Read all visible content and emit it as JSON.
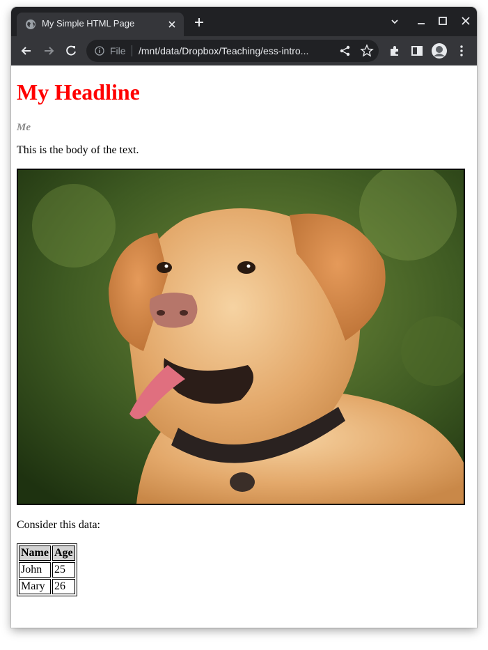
{
  "browser": {
    "tab_title": "My Simple HTML Page",
    "url_scheme": "File",
    "url": "/mnt/data/Dropbox/Teaching/ess-intro..."
  },
  "page": {
    "headline": "My Headline",
    "headline_color": "#ff0000",
    "author": "Me",
    "body_text": "This is the body of the text.",
    "image_alt": "Golden retriever dog photo",
    "consider_text": "Consider this data:",
    "table": {
      "headers": [
        "Name",
        "Age"
      ],
      "rows": [
        [
          "John",
          "25"
        ],
        [
          "Mary",
          "26"
        ]
      ]
    }
  },
  "colors": {
    "tabstrip": "#202124",
    "toolbar": "#35363a",
    "table_header_bg": "#d3d3d3"
  }
}
